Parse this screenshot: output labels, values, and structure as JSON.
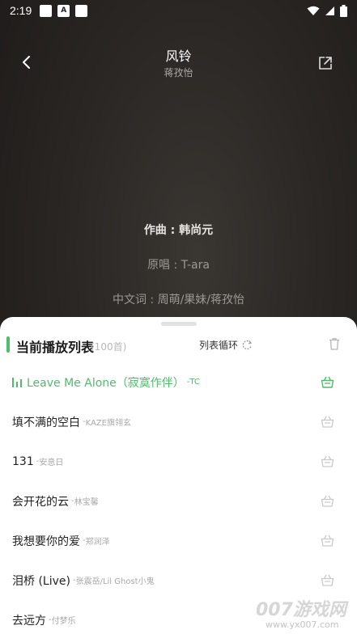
{
  "status_bar": {
    "time": "2:19",
    "icons": [
      "notification-square-icon",
      "a-letter-icon",
      "notification-square-icon"
    ],
    "right_icons": [
      "wifi-icon",
      "signal-icon",
      "battery-icon"
    ]
  },
  "header": {
    "title": "风铃",
    "artist": "蒋孜怡"
  },
  "lyrics": [
    {
      "text": "作曲 : 韩尚元",
      "current": true
    },
    {
      "text": "原唱 : T-ara",
      "current": false
    },
    {
      "text": "中文词 : 周萌/果妹/蒋孜怡",
      "current": false
    }
  ],
  "playlist": {
    "title": "当前播放列表",
    "count": "(100首)",
    "loop_mode": "列表循环",
    "accent_color": "#4cbf6b",
    "tracks": [
      {
        "name": "Leave Me Alone（寂寞作伴）",
        "sep": " - ",
        "singer": "TC",
        "active": true
      },
      {
        "name": "填不满的空白",
        "sep": " - ",
        "singer": "KAZE旗翎玄",
        "active": false
      },
      {
        "name": "131",
        "sep": " - ",
        "singer": "安息日",
        "active": false
      },
      {
        "name": "会开花的云",
        "sep": " - ",
        "singer": "林宝馨",
        "active": false
      },
      {
        "name": "我想要你的爱",
        "sep": " - ",
        "singer": "郑润泽",
        "active": false
      },
      {
        "name": "泪桥 (Live)",
        "sep": " - ",
        "singer": "张震岳/Lil Ghost小鬼",
        "active": false
      },
      {
        "name": "去远方",
        "sep": " - ",
        "singer": "付梦乐",
        "active": false
      }
    ]
  },
  "watermark": {
    "top": "007游戏网",
    "bottom": "www.yx007.com"
  }
}
